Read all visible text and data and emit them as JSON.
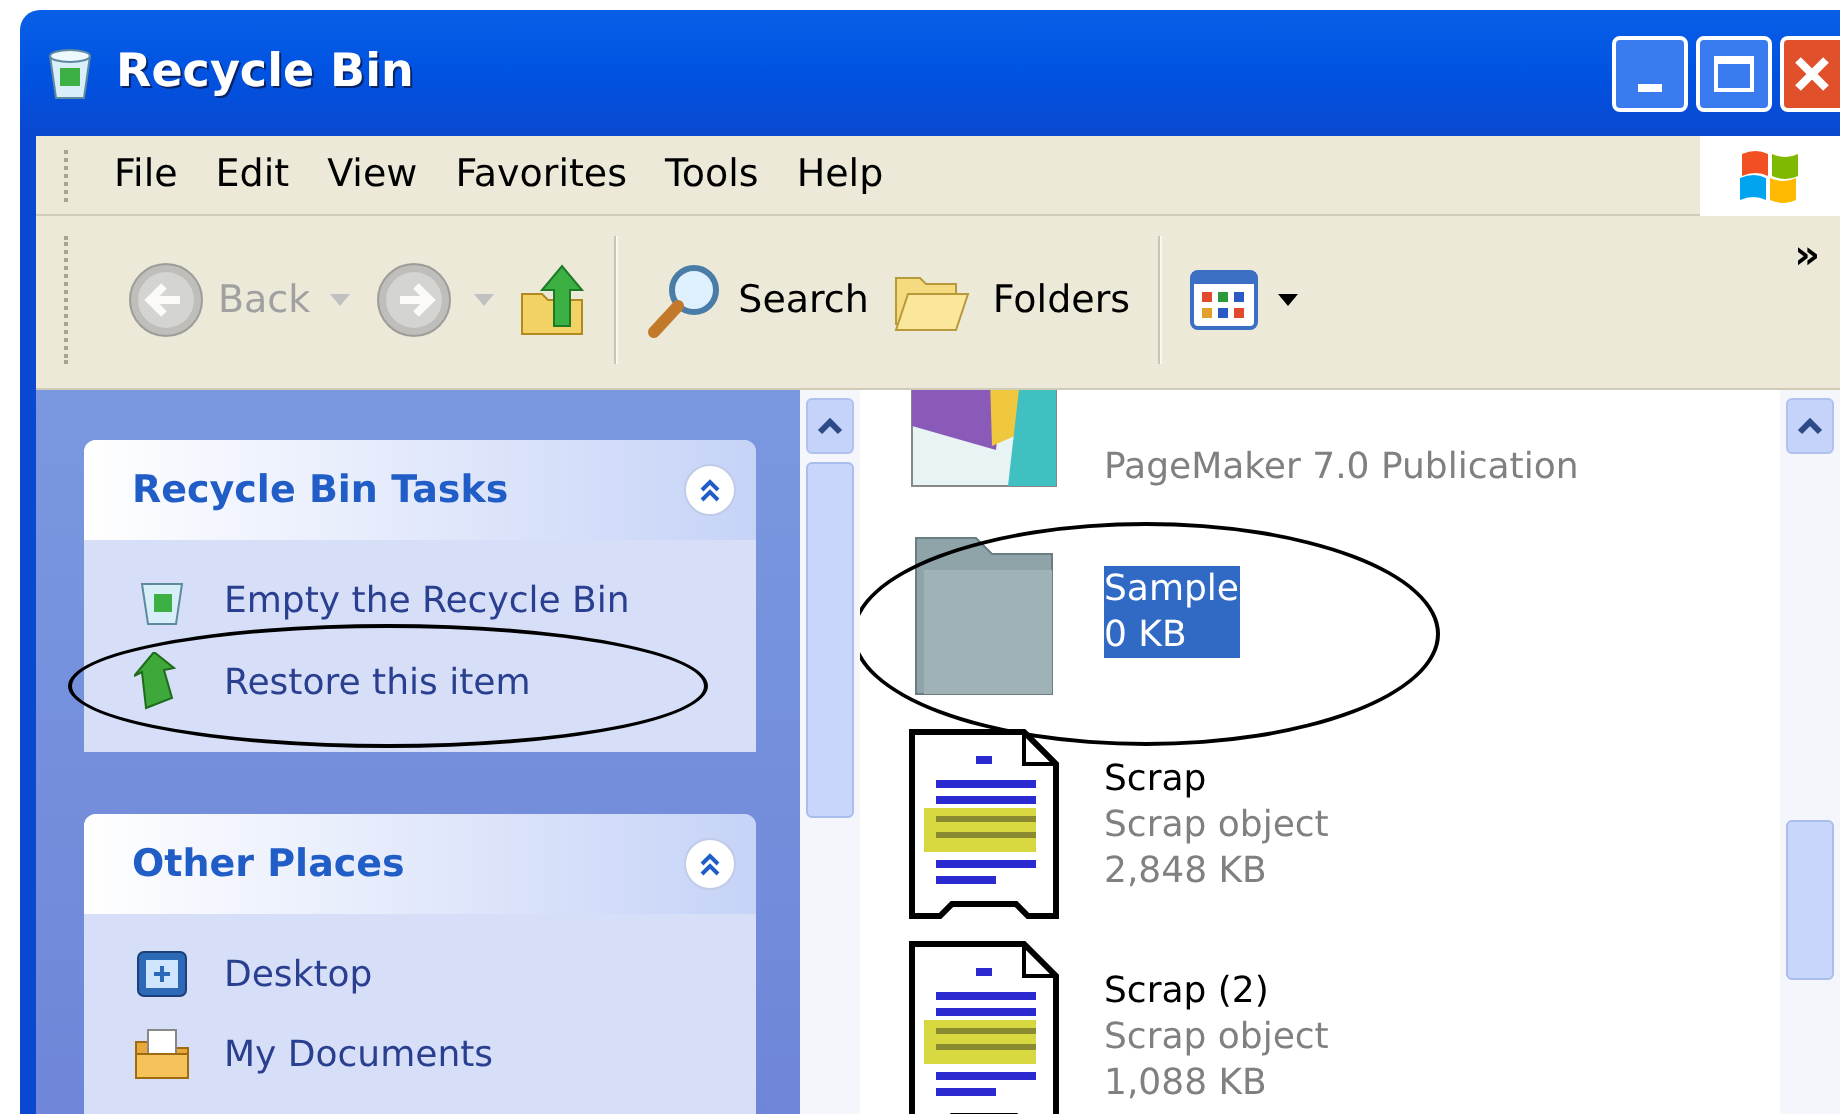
{
  "window": {
    "title": "Recycle Bin"
  },
  "menu": [
    {
      "label": "File"
    },
    {
      "label": "Edit"
    },
    {
      "label": "View"
    },
    {
      "label": "Favorites"
    },
    {
      "label": "Tools"
    },
    {
      "label": "Help"
    }
  ],
  "toolbar": {
    "buttons": [
      {
        "kind": "back",
        "label": "Back",
        "disabled": true
      },
      {
        "kind": "forward",
        "disabled": true
      },
      {
        "kind": "up",
        "disabled": false
      },
      {
        "kind": "search",
        "label": "Search",
        "disabled": false
      },
      {
        "kind": "folders",
        "label": "Folders",
        "disabled": false
      },
      {
        "kind": "views",
        "disabled": false
      }
    ],
    "overflow": "»"
  },
  "sidebar": {
    "panels": [
      {
        "title": "Recycle Bin Tasks",
        "expanded": true,
        "items": [
          {
            "kind": "empty-bin",
            "label": "Empty the Recycle Bin",
            "circled": false
          },
          {
            "kind": "restore",
            "label": "Restore this item",
            "circled": true
          }
        ]
      },
      {
        "title": "Other Places",
        "expanded": true,
        "items": [
          {
            "kind": "desktop",
            "label": "Desktop",
            "circled": false
          },
          {
            "kind": "documents",
            "label": "My Documents",
            "circled": false
          }
        ]
      }
    ]
  },
  "files": [
    {
      "kind": "pagemaker",
      "details": [
        "PageMaker 7.0 Publication"
      ],
      "selected": false,
      "circled": false
    },
    {
      "kind": "folder",
      "name": "Sample",
      "details": [
        "0 KB"
      ],
      "selected": true,
      "circled": true
    },
    {
      "kind": "scrap",
      "name": "Scrap",
      "details": [
        "Scrap object",
        "2,848 KB"
      ],
      "selected": false,
      "circled": false
    },
    {
      "kind": "scrap",
      "name": "Scrap (2)",
      "details": [
        "Scrap object",
        "1,088 KB"
      ],
      "selected": false,
      "circled": false
    }
  ]
}
